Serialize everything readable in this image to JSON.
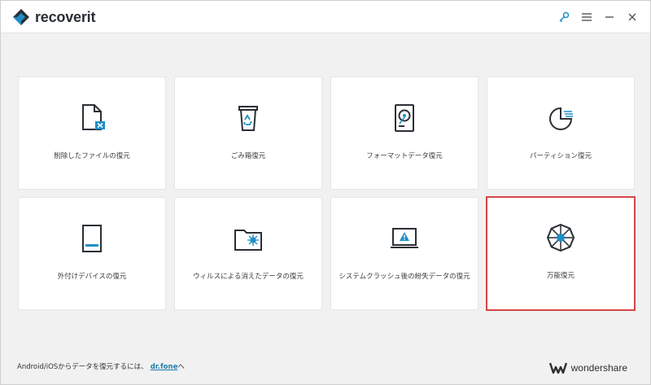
{
  "app": {
    "name": "recoverit",
    "accent": "#1e8fc6",
    "dark": "#2a2f36",
    "selected_border": "#d64545"
  },
  "window_controls": {
    "key_icon": "key-icon",
    "menu_icon": "hamburger-menu-icon",
    "minimize_icon": "minimize-icon",
    "close_icon": "close-icon"
  },
  "cards": [
    {
      "label": "削除したファイルの復元",
      "icon": "deleted-file-icon"
    },
    {
      "label": "ごみ箱復元",
      "icon": "recycle-bin-icon"
    },
    {
      "label": "フォーマットデータ復元",
      "icon": "formatted-drive-icon"
    },
    {
      "label": "パーティション復元",
      "icon": "partition-pie-icon"
    },
    {
      "label": "外付けデバイスの復元",
      "icon": "external-device-icon"
    },
    {
      "label": "ウィルスによる消えたデータの復元",
      "icon": "virus-folder-icon"
    },
    {
      "label": "システムクラッシュ後の紛失データの復元",
      "icon": "system-crash-laptop-icon"
    },
    {
      "label": "万能復元",
      "icon": "all-round-recovery-icon",
      "selected": true
    }
  ],
  "footer": {
    "text": "Android/iOSからデータを復元するには、",
    "link": "dr.fone",
    "link_suffix": "へ",
    "brand": "wondershare"
  }
}
